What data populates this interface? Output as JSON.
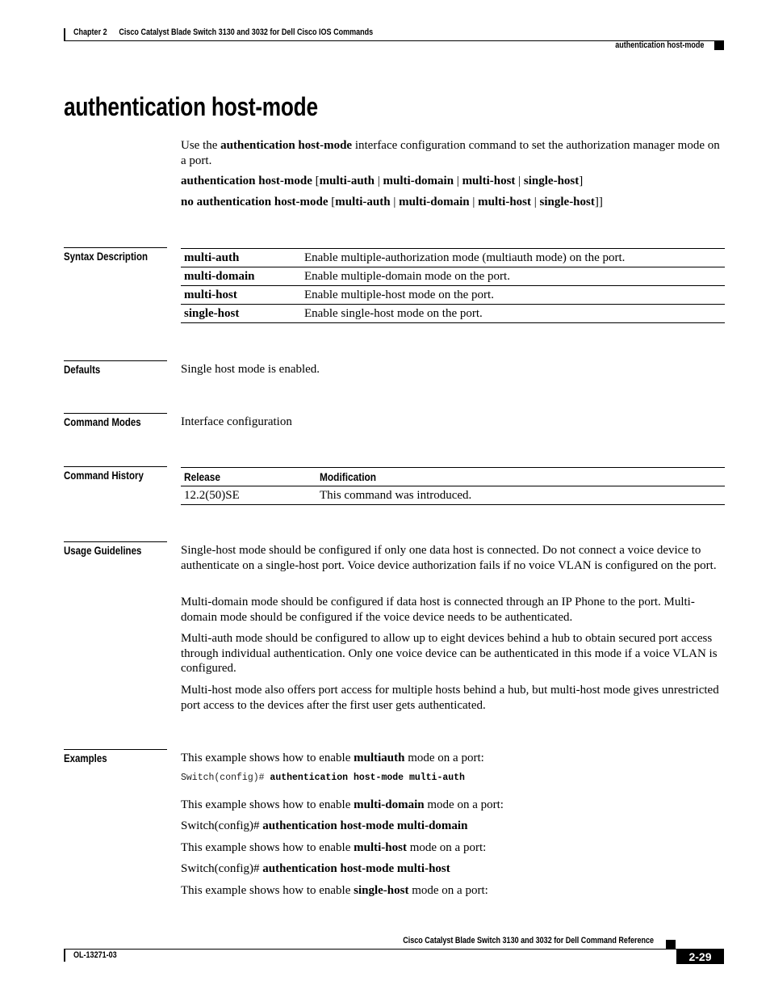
{
  "header": {
    "chapter": "Chapter 2",
    "book_title": "Cisco Catalyst Blade Switch 3130 and 3032 for Dell Cisco IOS Commands",
    "section": "authentication host-mode"
  },
  "title": "authentication host-mode",
  "intro": {
    "pre": "Use the ",
    "bold": "authentication host-mode",
    "post": " interface configuration command to set the authorization manager mode on a port."
  },
  "syntax": {
    "line1": {
      "cmd": "authentication host-mode",
      "open": " [",
      "opts": [
        "multi-auth",
        "multi-domain",
        "multi-host",
        "single-host"
      ],
      "sep": " | ",
      "close": "]"
    },
    "line2": {
      "cmd": "no authentication host-mode",
      "open": " [",
      "opts": [
        "multi-auth",
        "multi-domain",
        "multi-host",
        "single-host"
      ],
      "sep": " | ",
      "close": "]]"
    }
  },
  "sections": {
    "syntax_description": "Syntax Description",
    "defaults": "Defaults",
    "command_modes": "Command Modes",
    "command_history": "Command History",
    "usage_guidelines": "Usage Guidelines",
    "examples": "Examples"
  },
  "syntax_description": [
    {
      "keyword": "multi-auth",
      "description": "Enable multiple-authorization mode (multiauth mode) on the port."
    },
    {
      "keyword": "multi-domain",
      "description": "Enable multiple-domain mode on the port."
    },
    {
      "keyword": "multi-host",
      "description": "Enable multiple-host mode on the port."
    },
    {
      "keyword": "single-host",
      "description": "Enable single-host mode on the port."
    }
  ],
  "defaults": "Single host mode is enabled.",
  "command_modes": "Interface configuration",
  "command_history": {
    "headers": [
      "Release",
      "Modification"
    ],
    "rows": [
      {
        "release": "12.2(50)SE",
        "modification": "This command was introduced."
      }
    ]
  },
  "usage_guidelines": [
    "Single-host mode should be configured if only one data host is connected. Do not connect a voice device to authenticate on a single-host port. Voice device authorization fails if no voice VLAN is configured on the port.",
    "Multi-domain mode should be configured if data host is connected through an IP Phone to the port. Multi-domain mode should be configured if the voice device needs to be authenticated.",
    "Multi-auth mode should be configured to allow up to eight devices behind a hub to obtain secured port access through individual authentication. Only one voice device can be authenticated in this mode if a voice VLAN is configured.",
    "Multi-host mode also offers port access for multiple hosts behind a hub, but multi-host mode gives unrestricted port access to the devices after the first user gets authenticated."
  ],
  "examples": [
    {
      "pre": "This example shows how to enable ",
      "bold": "multiauth",
      "post": " mode on a port:",
      "prompt": "Switch(config)# ",
      "command": "authentication host-mode multi-auth"
    },
    {
      "pre": "This example shows how to enable ",
      "bold": "multi-domain",
      "post": " mode on a port:",
      "prompt": "Switch(config)# ",
      "command": "authentication host-mode multi-domain"
    },
    {
      "pre": "This example shows how to enable ",
      "bold": "multi-host",
      "post": " mode on a port:",
      "prompt": "Switch(config)# ",
      "command": "authentication host-mode multi-host"
    },
    {
      "pre": "This example shows how to enable ",
      "bold": "single-host",
      "post": " mode on a port:"
    }
  ],
  "footer": {
    "book_title": "Cisco Catalyst Blade Switch 3130 and 3032 for Dell Command Reference",
    "doc_number": "OL-13271-03",
    "page": "2-29"
  }
}
